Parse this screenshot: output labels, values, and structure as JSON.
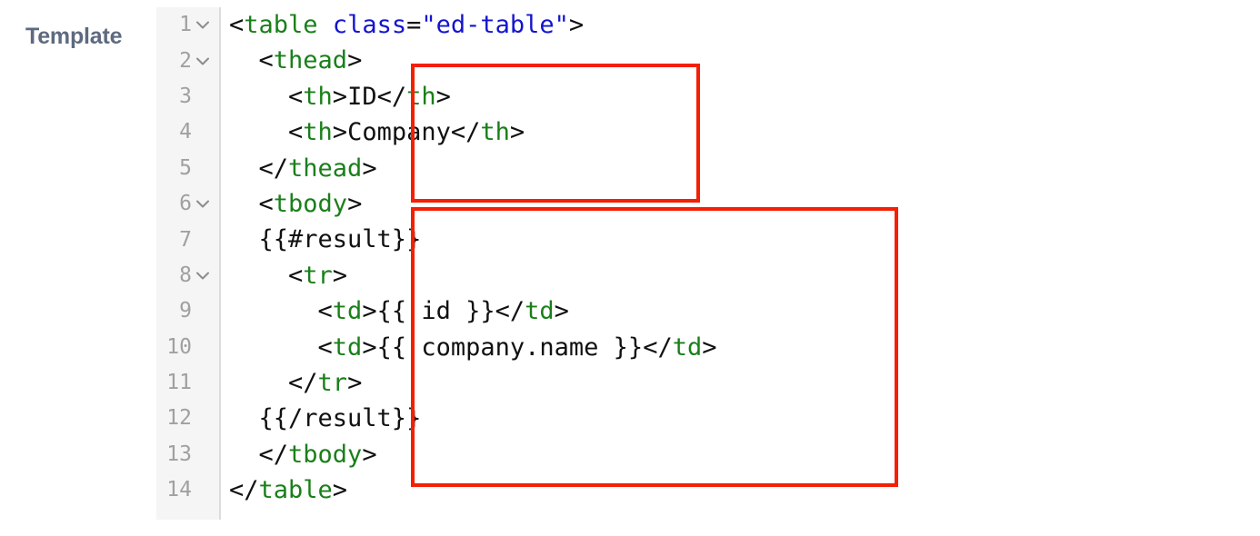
{
  "panel": {
    "label": "Template"
  },
  "editor": {
    "language": "html",
    "fold_chevron_icon": "chevron-down-icon",
    "gutter_line_numbers": [
      "1",
      "2",
      "3",
      "4",
      "5",
      "6",
      "7",
      "8",
      "9",
      "10",
      "11",
      "12",
      "13",
      "14"
    ],
    "foldable_lines": [
      1,
      2,
      6,
      8
    ],
    "lines": [
      {
        "number": "1",
        "foldable": true,
        "text": "<table class=\"ed-table\">",
        "tokens": [
          {
            "t": "punc",
            "v": "<"
          },
          {
            "t": "tag",
            "v": "table"
          },
          {
            "t": "punc",
            "v": " "
          },
          {
            "t": "attr",
            "v": "class"
          },
          {
            "t": "punc",
            "v": "="
          },
          {
            "t": "str",
            "v": "\"ed-table\""
          },
          {
            "t": "punc",
            "v": ">"
          }
        ]
      },
      {
        "number": "2",
        "foldable": true,
        "text": "  <thead>",
        "tokens": [
          {
            "t": "punc",
            "v": "  <"
          },
          {
            "t": "tag",
            "v": "thead"
          },
          {
            "t": "punc",
            "v": ">"
          }
        ]
      },
      {
        "number": "3",
        "foldable": false,
        "text": "    <th>ID</th>",
        "tokens": [
          {
            "t": "punc",
            "v": "    <"
          },
          {
            "t": "tag",
            "v": "th"
          },
          {
            "t": "punc",
            "v": ">"
          },
          {
            "t": "txt",
            "v": "ID"
          },
          {
            "t": "punc",
            "v": "</"
          },
          {
            "t": "tag",
            "v": "th"
          },
          {
            "t": "punc",
            "v": ">"
          }
        ]
      },
      {
        "number": "4",
        "foldable": false,
        "text": "    <th>Company</th>",
        "tokens": [
          {
            "t": "punc",
            "v": "    <"
          },
          {
            "t": "tag",
            "v": "th"
          },
          {
            "t": "punc",
            "v": ">"
          },
          {
            "t": "txt",
            "v": "Company"
          },
          {
            "t": "punc",
            "v": "</"
          },
          {
            "t": "tag",
            "v": "th"
          },
          {
            "t": "punc",
            "v": ">"
          }
        ]
      },
      {
        "number": "5",
        "foldable": false,
        "text": "  </thead>",
        "tokens": [
          {
            "t": "punc",
            "v": "  </"
          },
          {
            "t": "tag",
            "v": "thead"
          },
          {
            "t": "punc",
            "v": ">"
          }
        ]
      },
      {
        "number": "6",
        "foldable": true,
        "text": "  <tbody>",
        "tokens": [
          {
            "t": "punc",
            "v": "  <"
          },
          {
            "t": "tag",
            "v": "tbody"
          },
          {
            "t": "punc",
            "v": ">"
          }
        ]
      },
      {
        "number": "7",
        "foldable": false,
        "text": "  {{#result}}",
        "tokens": [
          {
            "t": "moust",
            "v": "  {{#result}}"
          }
        ]
      },
      {
        "number": "8",
        "foldable": true,
        "text": "    <tr>",
        "tokens": [
          {
            "t": "punc",
            "v": "    <"
          },
          {
            "t": "tag",
            "v": "tr"
          },
          {
            "t": "punc",
            "v": ">"
          }
        ]
      },
      {
        "number": "9",
        "foldable": false,
        "text": "      <td>{{ id }}</td>",
        "tokens": [
          {
            "t": "punc",
            "v": "      <"
          },
          {
            "t": "tag",
            "v": "td"
          },
          {
            "t": "punc",
            "v": ">"
          },
          {
            "t": "moust",
            "v": "{{ id }}"
          },
          {
            "t": "punc",
            "v": "</"
          },
          {
            "t": "tag",
            "v": "td"
          },
          {
            "t": "punc",
            "v": ">"
          }
        ]
      },
      {
        "number": "10",
        "foldable": false,
        "text": "      <td>{{ company.name }}</td>",
        "tokens": [
          {
            "t": "punc",
            "v": "      <"
          },
          {
            "t": "tag",
            "v": "td"
          },
          {
            "t": "punc",
            "v": ">"
          },
          {
            "t": "moust",
            "v": "{{ company.name }}"
          },
          {
            "t": "punc",
            "v": "</"
          },
          {
            "t": "tag",
            "v": "td"
          },
          {
            "t": "punc",
            "v": ">"
          }
        ]
      },
      {
        "number": "11",
        "foldable": false,
        "text": "    </tr>",
        "tokens": [
          {
            "t": "punc",
            "v": "    </"
          },
          {
            "t": "tag",
            "v": "tr"
          },
          {
            "t": "punc",
            "v": ">"
          }
        ]
      },
      {
        "number": "12",
        "foldable": false,
        "text": "  {{/result}}",
        "tokens": [
          {
            "t": "moust",
            "v": "  {{/result}}"
          }
        ]
      },
      {
        "number": "13",
        "foldable": false,
        "text": "  </tbody>",
        "tokens": [
          {
            "t": "punc",
            "v": "  </"
          },
          {
            "t": "tag",
            "v": "tbody"
          },
          {
            "t": "punc",
            "v": ">"
          }
        ]
      },
      {
        "number": "14",
        "foldable": false,
        "text": "</table>",
        "tokens": [
          {
            "t": "punc",
            "v": "</"
          },
          {
            "t": "tag",
            "v": "table"
          },
          {
            "t": "punc",
            "v": ">"
          }
        ]
      }
    ]
  },
  "annotations": [
    {
      "id": "annot-thead",
      "name": "thead-highlight-box",
      "covers_lines": [
        "2",
        "3",
        "4",
        "5"
      ],
      "color": "#f41f05"
    },
    {
      "id": "annot-tbody",
      "name": "tbody-highlight-box",
      "covers_lines": [
        "6",
        "7",
        "8",
        "9",
        "10",
        "11",
        "12",
        "13"
      ],
      "color": "#f41f05"
    }
  ],
  "colors": {
    "background": "#ffffff",
    "gutter_background": "#f5f5f5",
    "gutter_border": "#dcdcdc",
    "line_number": "#a0a0a0",
    "label_text": "#5d6a80",
    "tag": "#1a7f1a",
    "attribute": "#1414cf",
    "string": "#1414cf",
    "punctuation": "#111111",
    "text": "#111111",
    "annotation": "#f41f05"
  }
}
